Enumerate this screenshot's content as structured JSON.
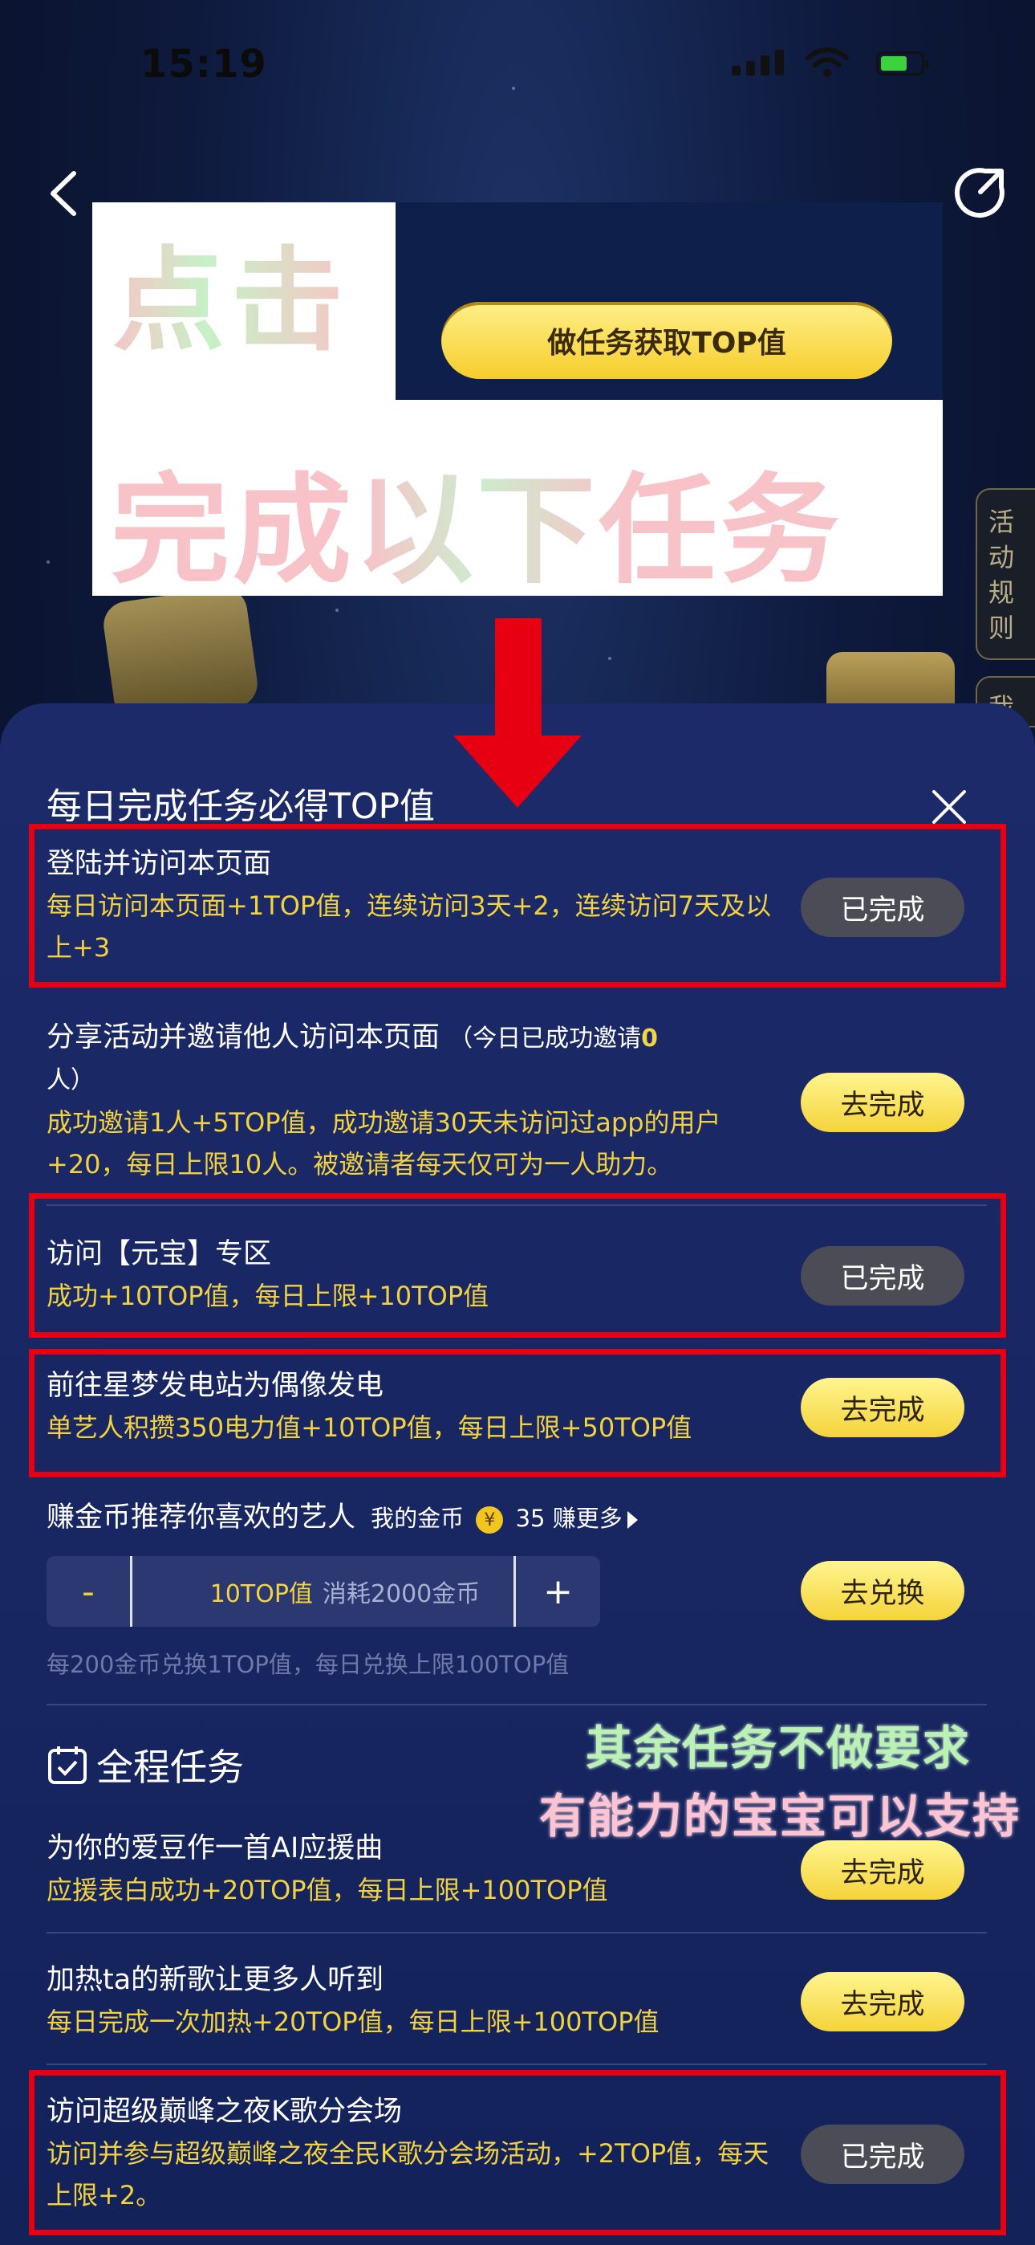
{
  "status_bar": {
    "time": "15:19"
  },
  "banner": {
    "cta": "做任务获取TOP值",
    "overlay_click": "点击",
    "overlay_complete": "完成以下任务"
  },
  "side_tabs": {
    "rules": "活动规则",
    "mine": "我"
  },
  "sheet": {
    "title": "每日完成任务必得TOP值",
    "tasks": [
      {
        "title": "登陆并访问本页面",
        "subtitle": "每日访问本页面+1TOP值，连续访问3天+2，连续访问7天及以上+3",
        "button": "已完成"
      },
      {
        "title": "分享活动并邀请他人访问本页面",
        "note_prefix": "（今日已成功邀请",
        "note_count": "0",
        "note_suffix": "人）",
        "subtitle": "成功邀请1人+5TOP值，成功邀请30天未访问过app的用户+20，每日上限10人。被邀请者每天仅可为一人助力。",
        "button": "去完成"
      },
      {
        "title": "访问【元宝】专区",
        "subtitle": "成功+10TOP值，每日上限+10TOP值",
        "button": "已完成"
      },
      {
        "title": "前往星梦发电站为偶像发电",
        "subtitle": "单艺人积攒350电力值+10TOP值，每日上限+50TOP值",
        "button": "去完成"
      }
    ],
    "exchange": {
      "title": "赚金币推荐你喜欢的艺人",
      "my_coins_label": "我的金币",
      "coin_symbol": "¥",
      "coin_count": "35",
      "earn_more": "赚更多",
      "minus": "-",
      "amount": "10TOP值",
      "cost": "消耗2000金币",
      "plus": "+",
      "button": "去兑换",
      "hint": "每200金币兑换1TOP值，每日兑换上限100TOP值"
    },
    "section_title": "全程任务",
    "overlay_line1": "其余任务不做要求",
    "overlay_line2": "有能力的宝宝可以支持",
    "full_tasks": [
      {
        "title": "为你的爱豆作一首AI应援曲",
        "subtitle": "应援表白成功+20TOP值，每日上限+100TOP值",
        "button": "去完成"
      },
      {
        "title": "加热ta的新歌让更多人听到",
        "subtitle": "每日完成一次加热+20TOP值，每日上限+100TOP值",
        "button": "去完成"
      },
      {
        "title": "访问超级巅峰之夜K歌分会场",
        "subtitle": "访问并参与超级巅峰之夜全民K歌分会场活动，+2TOP值，每天上限+2。",
        "button": "已完成"
      }
    ]
  },
  "colors": {
    "accent_yellow": "#f5d33a",
    "highlight_red": "#e60012",
    "sheet_bg": "#1c2a6a"
  }
}
